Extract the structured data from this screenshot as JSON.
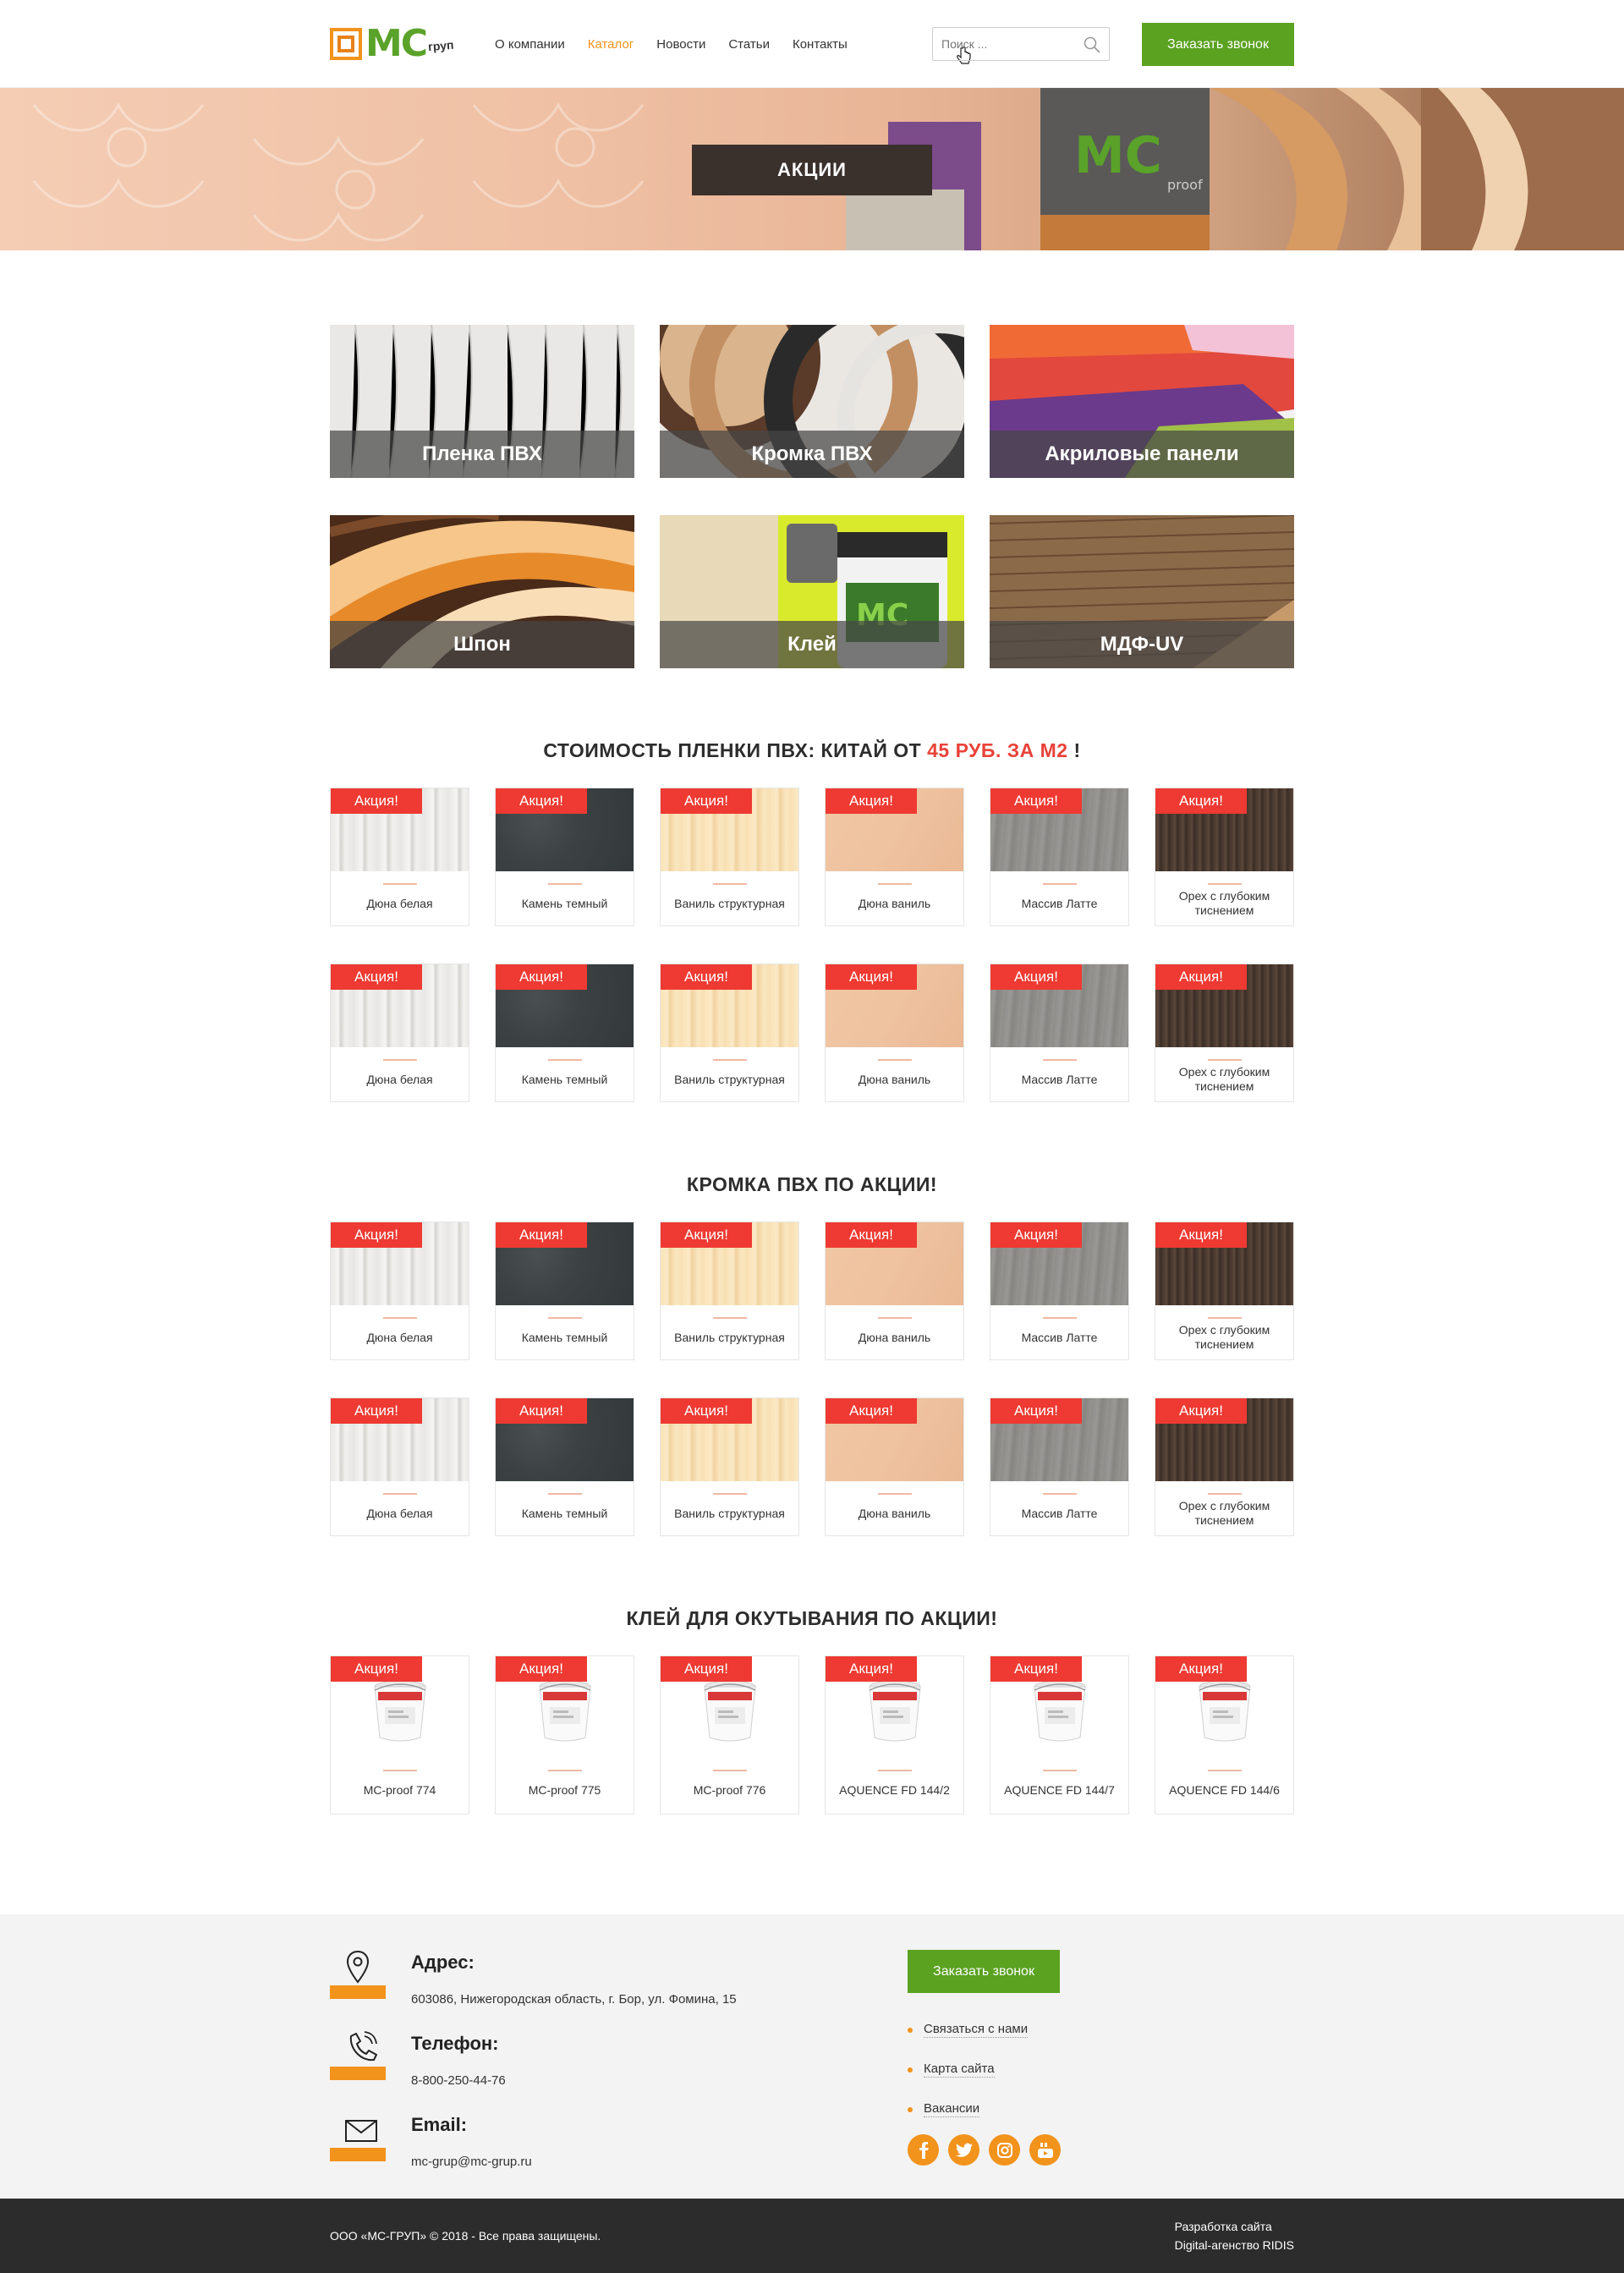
{
  "header": {
    "logo": {
      "mark": "МС",
      "sub": "груп"
    },
    "nav": [
      {
        "label": "О компании",
        "active": false
      },
      {
        "label": "Каталог",
        "active": true
      },
      {
        "label": "Новости",
        "active": false
      },
      {
        "label": "Статьи",
        "active": false
      },
      {
        "label": "Контакты",
        "active": false
      }
    ],
    "search_placeholder": "Поиск ...",
    "call_button": "Заказать звонок"
  },
  "banner": {
    "title": "АКЦИИ"
  },
  "categories": [
    {
      "label": "Пленка ПВХ"
    },
    {
      "label": "Кромка ПВХ"
    },
    {
      "label": "Акриловые панели"
    },
    {
      "label": "Шпон"
    },
    {
      "label": "Клей"
    },
    {
      "label": "МДФ-UV"
    }
  ],
  "sections": [
    {
      "title_pre": "СТОИМОСТЬ ПЛЕНКИ ПВХ: КИТАЙ ОТ ",
      "title_red": "45 РУБ. ЗА М2",
      "title_post": " !",
      "badge": "Акция!",
      "rows": [
        [
          "Дюна белая",
          "Камень темный",
          "Ваниль структурная",
          "Дюна ваниль",
          "Массив Латте",
          "Орех с глубоким тиснением"
        ],
        [
          "Дюна белая",
          "Камень темный",
          "Ваниль структурная",
          "Дюна ваниль",
          "Массив Латте",
          "Орех с глубоким тиснением"
        ]
      ]
    },
    {
      "title_pre": "КРОМКА ПВХ ПО АКЦИИ!",
      "title_red": "",
      "title_post": "",
      "badge": "Акция!",
      "rows": [
        [
          "Дюна белая",
          "Камень темный",
          "Ваниль структурная",
          "Дюна ваниль",
          "Массив Латте",
          "Орех с глубоким тиснением"
        ],
        [
          "Дюна белая",
          "Камень темный",
          "Ваниль структурная",
          "Дюна ваниль",
          "Массив Латте",
          "Орех с глубоким тиснением"
        ]
      ]
    },
    {
      "title_pre": "КЛЕЙ ДЛЯ ОКУТЫВАНИЯ ПО АКЦИИ!",
      "title_red": "",
      "title_post": "",
      "badge": "Акция!",
      "rows": [
        [
          "MC-proof 774",
          "MC-proof 775",
          "MC-proof 776",
          "AQUENCE FD 144/2",
          "AQUENCE FD 144/7",
          "AQUENCE FD 144/6"
        ]
      ]
    }
  ],
  "footer": {
    "address_label": "Адрес:",
    "address": "603086, Нижегородская область, г. Бор, ул. Фомина, 15",
    "phone_label": "Телефон:",
    "phone": "8-800-250-44-76",
    "email_label": "Email:",
    "email": "mc-grup@mc-grup.ru",
    "call_button": "Заказать звонок",
    "links": [
      "Связаться с нами",
      "Карта сайта",
      "Вакансии"
    ],
    "social": [
      "facebook-icon",
      "twitter-icon",
      "instagram-icon",
      "youtube-icon"
    ]
  },
  "bottom": {
    "copyright": "ООО «МС-ГРУП» © 2018 - Все права защищены.",
    "dev_line1": "Разработка сайта",
    "dev_line2": "Digital-агенство RIDIS"
  },
  "colors": {
    "accent": "#f2931c",
    "green": "#5aa220",
    "red": "#ee3a32",
    "dark": "#2c2c2c"
  }
}
